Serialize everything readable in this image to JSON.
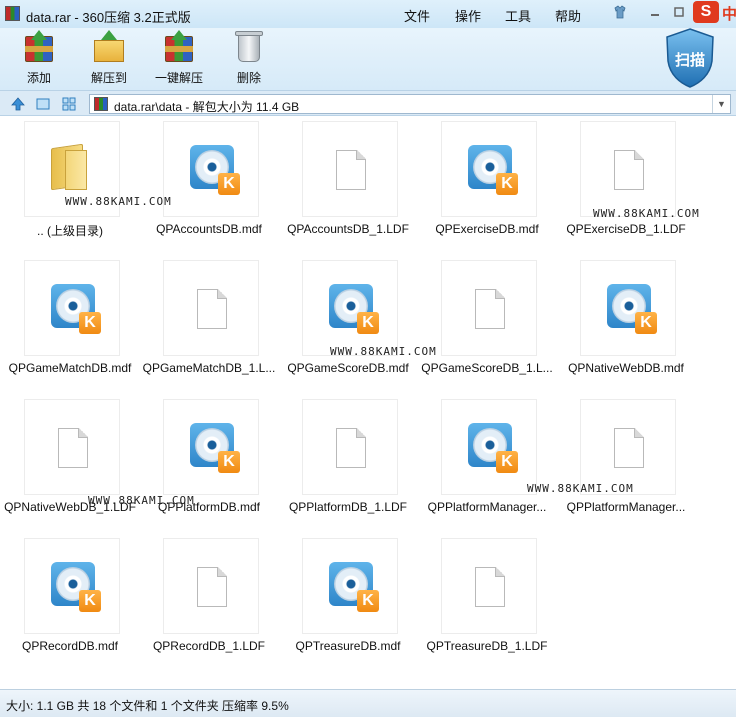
{
  "window": {
    "title": "data.rar - 360压缩 3.2正式版",
    "menu": [
      "文件",
      "操作",
      "工具",
      "帮助"
    ],
    "brand_letter": "S",
    "brand_text": "中"
  },
  "toolbar": {
    "add_label": "添加",
    "extract_to_label": "解压到",
    "one_click_extract_label": "一键解压",
    "delete_label": "删除",
    "scan_label": "扫描"
  },
  "address": {
    "path": "data.rar\\data - 解包大小为 11.4 GB"
  },
  "files": [
    {
      "name": ".. (上级目录)",
      "type": "folder"
    },
    {
      "name": "QPAccountsDB.mdf",
      "type": "mdf"
    },
    {
      "name": "QPAccountsDB_1.LDF",
      "type": "ldf"
    },
    {
      "name": "QPExerciseDB.mdf",
      "type": "mdf"
    },
    {
      "name": "QPExerciseDB_1.LDF",
      "type": "ldf"
    },
    {
      "name": "QPGameMatchDB.mdf",
      "type": "mdf"
    },
    {
      "name": "QPGameMatchDB_1.L...",
      "type": "ldf"
    },
    {
      "name": "QPGameScoreDB.mdf",
      "type": "mdf"
    },
    {
      "name": "QPGameScoreDB_1.L...",
      "type": "ldf"
    },
    {
      "name": "QPNativeWebDB.mdf",
      "type": "mdf"
    },
    {
      "name": "QPNativeWebDB_1.LDF",
      "type": "ldf"
    },
    {
      "name": "QPPlatformDB.mdf",
      "type": "mdf"
    },
    {
      "name": "QPPlatformDB_1.LDF",
      "type": "ldf"
    },
    {
      "name": "QPPlatformManager...",
      "type": "mdf"
    },
    {
      "name": "QPPlatformManager...",
      "type": "ldf"
    },
    {
      "name": "QPRecordDB.mdf",
      "type": "mdf"
    },
    {
      "name": "QPRecordDB_1.LDF",
      "type": "ldf"
    },
    {
      "name": "QPTreasureDB.mdf",
      "type": "mdf"
    },
    {
      "name": "QPTreasureDB_1.LDF",
      "type": "ldf"
    }
  ],
  "watermark": "WWW.88KAMI.COM",
  "status": {
    "text": "大小: 1.1 GB 共 18 个文件和 1 个文件夹 压缩率 9.5%"
  }
}
